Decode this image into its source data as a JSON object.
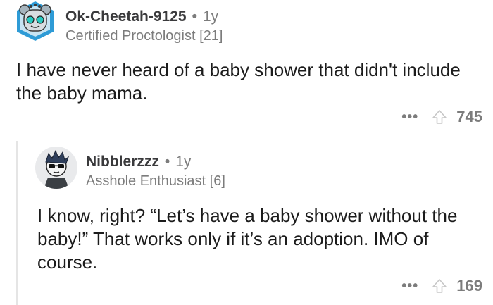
{
  "comments": [
    {
      "username": "Ok-Cheetah-9125",
      "dot": "•",
      "age": "1y",
      "flair": "Certified Proctologist [21]",
      "body": "I have never heard of a baby shower that didn't include the baby mama.",
      "more": "•••",
      "score": "745",
      "avatar_icon": "robot-snoo-avatar-icon",
      "upvote_icon": "upvote-arrow-icon"
    },
    {
      "username": "Nibblerzzz",
      "dot": "•",
      "age": "1y",
      "flair": "Asshole Enthusiast [6]",
      "body": "I know, right? “Let’s have a baby shower without the baby!”  That works only if it’s an adoption. IMO of course.",
      "more": "•••",
      "score": "169",
      "avatar_icon": "sunglasses-snoo-avatar-icon",
      "upvote_icon": "upvote-arrow-icon"
    }
  ],
  "colors": {
    "text": "#1c1c1c",
    "muted": "#7c7c7c",
    "thread_line": "#e5e5e5"
  }
}
